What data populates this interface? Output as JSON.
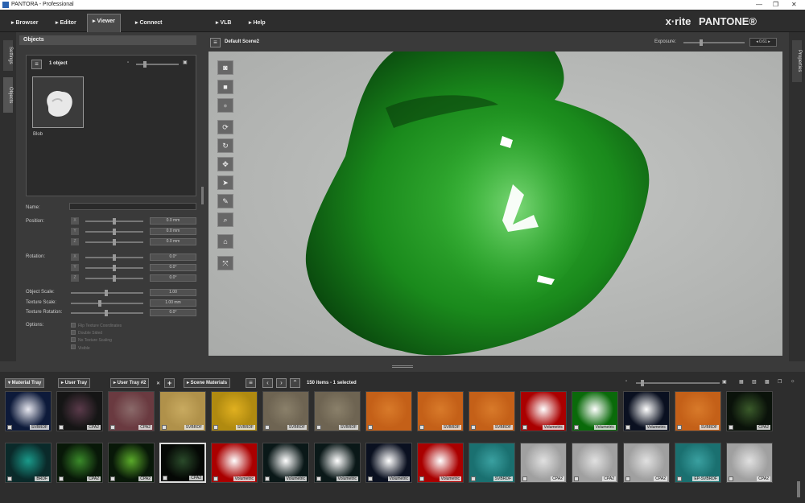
{
  "window": {
    "title": "PANTORA - Professional"
  },
  "menu": {
    "items": [
      "▸ Browser",
      "▸ Editor",
      "▸ Viewer",
      "▸ Connect",
      "▸ VLB",
      "▸ Help"
    ],
    "active": "Viewer"
  },
  "brand": {
    "xrite": "x·rite",
    "pantone": "PANTONE®"
  },
  "side": {
    "settings": "Settings",
    "objects": "Objects",
    "properties": "Properties"
  },
  "objects": {
    "panel_title": "Objects",
    "count": "1 object",
    "item_name": "Blob"
  },
  "props": {
    "name_label": "Name:",
    "position_label": "Position:",
    "rotation_label": "Rotation:",
    "object_scale_label": "Object Scale:",
    "texture_scale_label": "Texture Scale:",
    "texture_rotation_label": "Texture Rotation:",
    "options_label": "Options:",
    "axes": [
      "X",
      "Y",
      "Z"
    ],
    "pos_values": [
      "0.0 mm",
      "0.0 mm",
      "0.0 mm"
    ],
    "rot_values": [
      "0.0°",
      "0.0°",
      "0.0°"
    ],
    "object_scale": "1.00",
    "texture_scale": "1.00 mm",
    "texture_rotation": "0.0°",
    "options": [
      "Flip Texture Coordinates",
      "Double Sided",
      "No Texture Scaling",
      "Visible"
    ]
  },
  "viewer": {
    "scene": "Default Scene2",
    "exposure_label": "Exposure:",
    "exposure_value": "0.61"
  },
  "tray": {
    "tabs": [
      "▾ Material Tray",
      "▸ User Tray",
      "▸ User Tray #2",
      "✕",
      "+",
      "▸ Scene Materials"
    ],
    "status": "150 items - 1 selected",
    "row1": [
      {
        "label": "SVBRDF",
        "c": "#0d1a3a",
        "h": "#e8e8f0"
      },
      {
        "label": "CPA2",
        "c": "#151515",
        "h": "#5a3a4a"
      },
      {
        "label": "CPA2",
        "c": "#6a3a40",
        "h": "#8a6a6a"
      },
      {
        "label": "SVBRDF",
        "c": "#b0914a",
        "h": "#c8aa60"
      },
      {
        "label": "SVBRDF",
        "c": "#b08a10",
        "h": "#e0b020"
      },
      {
        "label": "SVBRDF",
        "c": "#6e6452",
        "h": "#8a806a"
      },
      {
        "label": "SVBRDF",
        "c": "#6e6452",
        "h": "#8a806a"
      },
      {
        "label": "",
        "c": "#c46018",
        "h": "#d87a2a"
      },
      {
        "label": "SVBRDF",
        "c": "#c46018",
        "h": "#d87a2a"
      },
      {
        "label": "SVBRDF",
        "c": "#c46018",
        "h": "#d87a2a"
      },
      {
        "label": "Volumetric",
        "c": "#aa0000",
        "h": "#ffffff"
      },
      {
        "label": "Volumetric",
        "c": "#0a6a0a",
        "h": "#ffffff"
      },
      {
        "label": "Volumetric",
        "c": "#0a1020",
        "h": "#ffffff"
      },
      {
        "label": "SVBRDF",
        "c": "#c46018",
        "h": "#d87a2a"
      },
      {
        "label": "CPA2",
        "c": "#0a120a",
        "h": "#3a5a2a"
      }
    ],
    "row2": [
      {
        "label": "BRDF",
        "c": "#0a2a2a",
        "h": "#1a9a8a"
      },
      {
        "label": "CPA2",
        "c": "#081808",
        "h": "#3a8a2a"
      },
      {
        "label": "CPA2",
        "c": "#081808",
        "h": "#5aaa2a"
      },
      {
        "label": "CPA2",
        "c": "#050805",
        "h": "#2a4a2a"
      },
      {
        "label": "Volumetric",
        "c": "#aa0000",
        "h": "#ffffff"
      },
      {
        "label": "Volumetric",
        "c": "#0a1818",
        "h": "#ffffff"
      },
      {
        "label": "Volumetric",
        "c": "#0a1818",
        "h": "#ffffff"
      },
      {
        "label": "Volumetric",
        "c": "#0a1020",
        "h": "#ffffff"
      },
      {
        "label": "Volumetric",
        "c": "#aa0000",
        "h": "#ffffff"
      },
      {
        "label": "SVBRDF",
        "c": "#1a7070",
        "h": "#3aa0a0"
      },
      {
        "label": "CPA2",
        "c": "#a0a0a0",
        "h": "#e0e0e0"
      },
      {
        "label": "CPA2",
        "c": "#a0a0a0",
        "h": "#e0e0e0"
      },
      {
        "label": "CPA2",
        "c": "#a0a0a0",
        "h": "#e0e0e0"
      },
      {
        "label": "EP-SVBRDF",
        "c": "#1a7070",
        "h": "#3aa0a0"
      },
      {
        "label": "CPA2",
        "c": "#a0a0a0",
        "h": "#e0e0e0"
      }
    ]
  }
}
